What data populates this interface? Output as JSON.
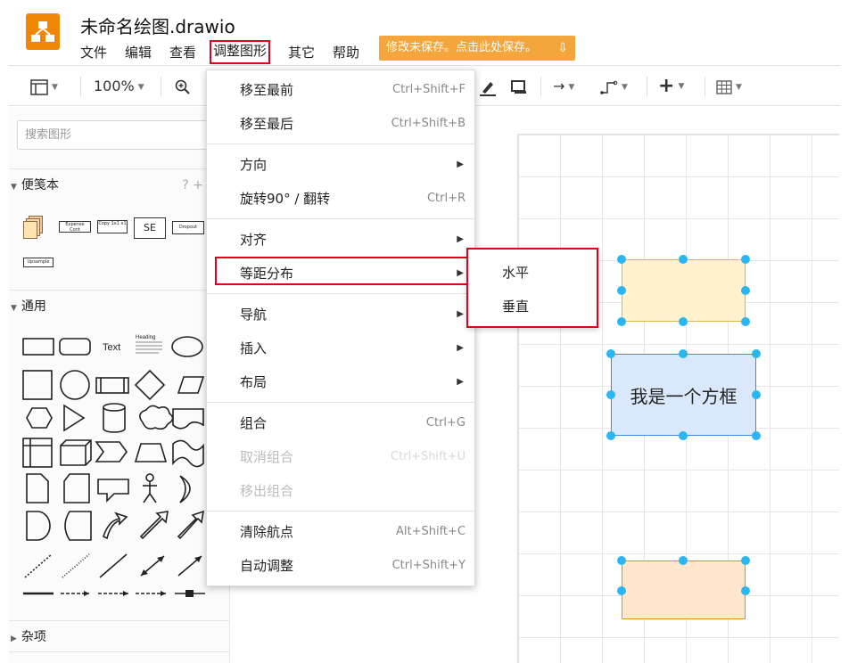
{
  "app": {
    "title": "未命名绘图.drawio",
    "save_notice": "修改未保存。点击此处保存。"
  },
  "menubar": [
    "文件",
    "编辑",
    "查看",
    "调整图形",
    "其它",
    "帮助"
  ],
  "toolbar": {
    "zoom": "100%"
  },
  "sidebar": {
    "search_placeholder": "搜索图形",
    "sections": [
      "便笺本",
      "通用",
      "杂项"
    ],
    "scratchpad_items": [
      "Expense Cont",
      "Copy 1x1 x1",
      "SE",
      "Dropout",
      "Upsample"
    ],
    "general_text_label": "Text",
    "general_heading_label": "Heading"
  },
  "arrange_menu": {
    "items": [
      {
        "label": "移至最前",
        "shortcut": "Ctrl+Shift+F"
      },
      {
        "label": "移至最后",
        "shortcut": "Ctrl+Shift+B"
      },
      {
        "label": "方向",
        "shortcut": ""
      },
      {
        "label": "旋转90° / 翻转",
        "shortcut": "Ctrl+R"
      },
      {
        "label": "对齐",
        "shortcut": ""
      },
      {
        "label": "等距分布",
        "shortcut": ""
      },
      {
        "label": "导航",
        "shortcut": ""
      },
      {
        "label": "插入",
        "shortcut": ""
      },
      {
        "label": "布局",
        "shortcut": ""
      },
      {
        "label": "组合",
        "shortcut": "Ctrl+G"
      },
      {
        "label": "取消组合",
        "shortcut": "Ctrl+Shift+U"
      },
      {
        "label": "移出组合",
        "shortcut": ""
      },
      {
        "label": "清除航点",
        "shortcut": "Alt+Shift+C"
      },
      {
        "label": "自动调整",
        "shortcut": "Ctrl+Shift+Y"
      }
    ]
  },
  "distribute_submenu": [
    "水平",
    "垂直"
  ],
  "canvas": {
    "box_label": "我是一个方框"
  },
  "colors": {
    "accent_red": "#e0001a",
    "logo_orange": "#f08705",
    "save_orange": "#f4a63d",
    "handle_blue": "#29b6f2",
    "box_yellow": "#fff2cc",
    "box_blue": "#dae8fc",
    "box_peach": "#ffe6cc"
  }
}
